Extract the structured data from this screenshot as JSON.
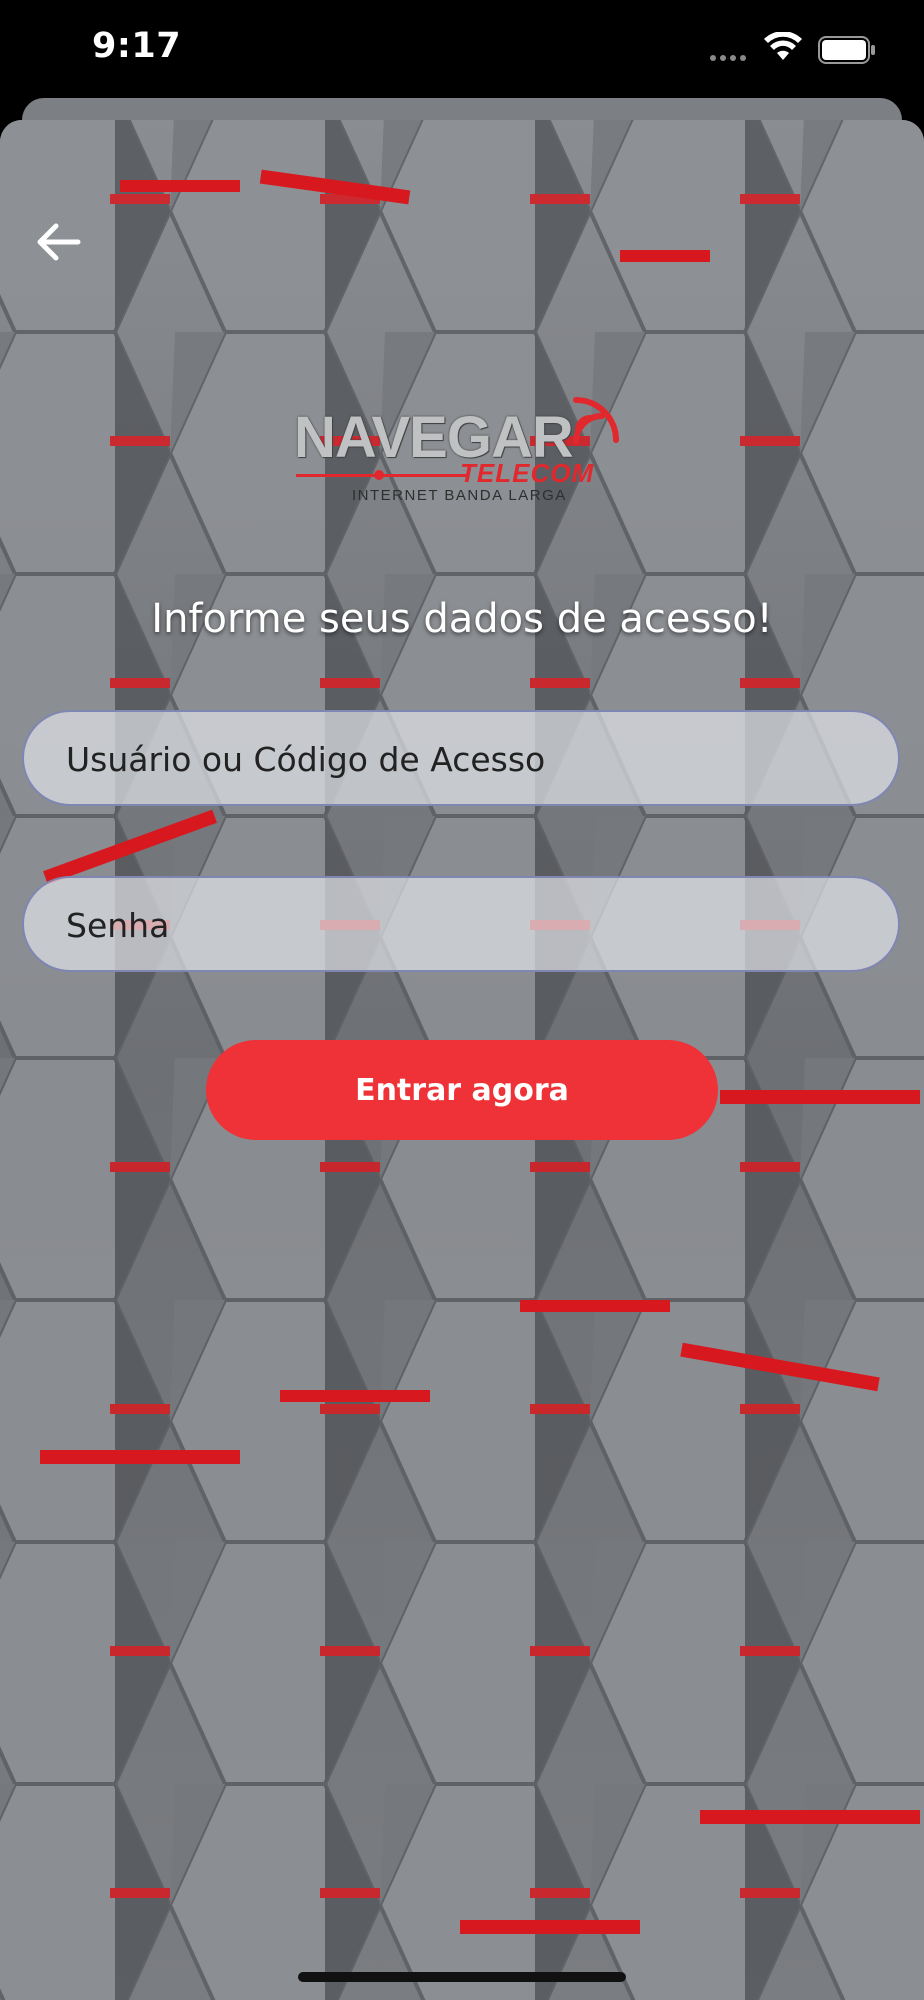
{
  "status_bar": {
    "time": "9:17",
    "icons": [
      "cellular-signal-icon",
      "wifi-icon",
      "battery-icon"
    ]
  },
  "navigation": {
    "back_icon": "arrow-left-icon"
  },
  "logo": {
    "brand": "NAVEGAR",
    "sub": "TELECOM",
    "tagline": "INTERNET BANDA LARGA",
    "icon": "signal-waves-icon"
  },
  "login": {
    "heading": "Informe seus dados de acesso!",
    "username_placeholder": "Usuário ou Código de Acesso",
    "username_value": "",
    "password_placeholder": "Senha",
    "password_value": "",
    "submit_label": "Entrar agora"
  },
  "colors": {
    "accent": "#ee3237",
    "field_border": "#7f86b3",
    "heading_text": "#ffffff"
  }
}
